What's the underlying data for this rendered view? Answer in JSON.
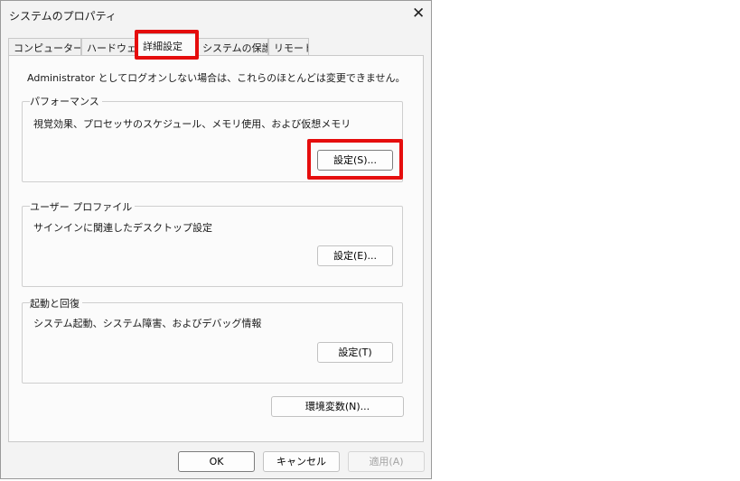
{
  "window": {
    "title": "システムのプロパティ",
    "close_glyph": "✕"
  },
  "tabs": [
    {
      "label": "コンピューター名",
      "active": false
    },
    {
      "label": "ハードウェア",
      "active": false
    },
    {
      "label": "詳細設定",
      "active": true
    },
    {
      "label": "システムの保護",
      "active": false
    },
    {
      "label": "リモート",
      "active": false
    }
  ],
  "intro": "Administrator としてログオンしない場合は、これらのほとんどは変更できません。",
  "groups": {
    "performance": {
      "title": "パフォーマンス",
      "description": "視覚効果、プロセッサのスケジュール、メモリ使用、および仮想メモリ",
      "button": "設定(S)..."
    },
    "user_profile": {
      "title": "ユーザー プロファイル",
      "description": "サインインに関連したデスクトップ設定",
      "button": "設定(E)..."
    },
    "startup_recovery": {
      "title": "起動と回復",
      "description": "システム起動、システム障害、およびデバッグ情報",
      "button": "設定(T)"
    }
  },
  "env_button": "環境変数(N)...",
  "footer": {
    "ok": "OK",
    "cancel": "キャンセル",
    "apply": "適用(A)"
  },
  "highlight_color": "#e50d0d"
}
